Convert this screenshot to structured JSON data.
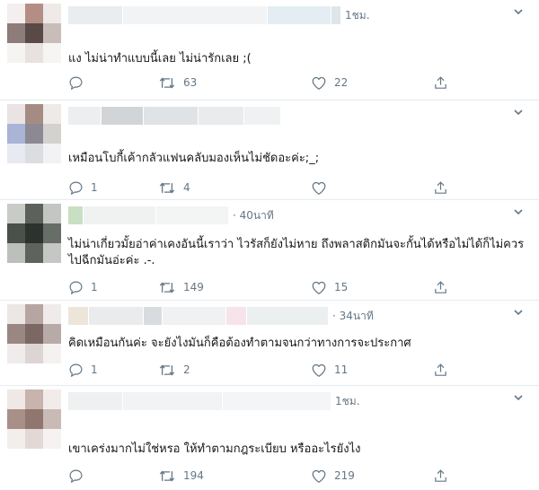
{
  "colors": {
    "text": "#14171a",
    "secondary": "#657786",
    "divider": "#e6ecf0",
    "icon": "#657786"
  },
  "tweets": [
    {
      "time": "1ชม.",
      "text": "แง ไม่น่าทำแบบนี้เลย ไม่น่ารักเลย ;(",
      "replies": "",
      "retweets": "63",
      "likes": "22"
    },
    {
      "time": "",
      "text": "เหมือนโบกี้เค้ากลัวแฟนคลับมองเห็นไม่ชัดอะค่ะ;_;",
      "replies": "1",
      "retweets": "4",
      "likes": ""
    },
    {
      "time": "· 40นาที",
      "text": "ไม่น่าเกี่ยวมั้ยอ่าค่าเคงอันนี้เราว่า ไวรัสก็ยังไม่หาย ถึงพลาสติกมันจะกั้นได้หรือไม่ได้ก็ไม่ควรไปฉีกมันอ่ะค่ะ .-.",
      "replies": "1",
      "retweets": "149",
      "likes": "15"
    },
    {
      "time": "· 34นาที",
      "text": "คิดเหมือนกันค่ะ จะยังไงมันก็คือต้องทำตามจนกว่าทางการจะประกาศ",
      "replies": "1",
      "retweets": "2",
      "likes": "11"
    },
    {
      "time": "1ชม.",
      "text": "เขาเคร่งมากไม่ใช่หรอ ให้ทำตามกฎระเบียบ หรืออะไรยังไง",
      "replies": "",
      "retweets": "194",
      "likes": "219"
    }
  ]
}
